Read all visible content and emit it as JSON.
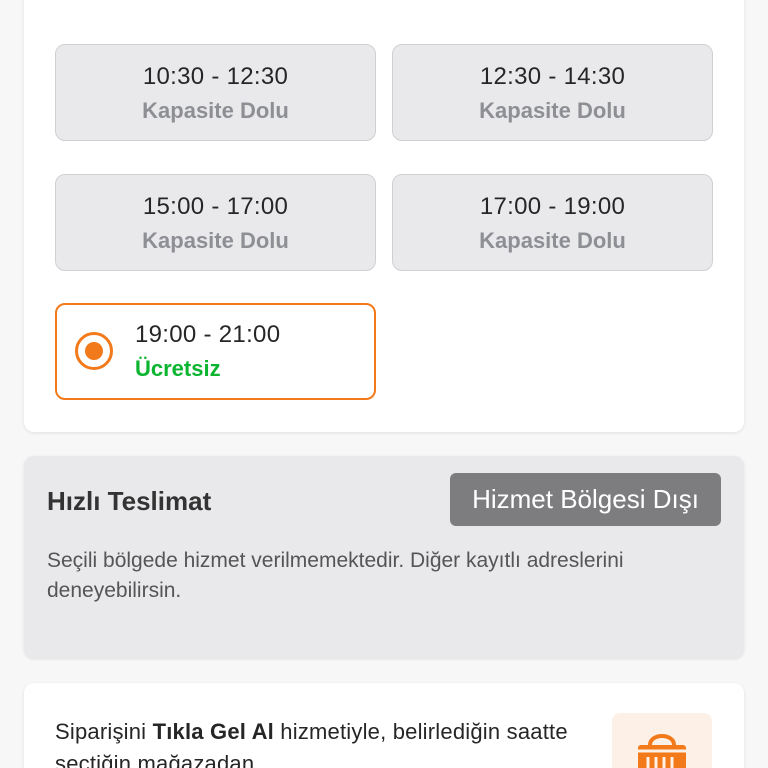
{
  "delivery_slots": {
    "slots": [
      {
        "time": "10:30 - 12:30",
        "status": "Kapasite Dolu"
      },
      {
        "time": "12:30 - 14:30",
        "status": "Kapasite Dolu"
      },
      {
        "time": "15:00 - 17:00",
        "status": "Kapasite Dolu"
      },
      {
        "time": "17:00 - 19:00",
        "status": "Kapasite Dolu"
      }
    ],
    "selected_slot": {
      "time": "19:00 - 21:00",
      "status": "Ücretsiz"
    }
  },
  "fast_delivery": {
    "title": "Hızlı Teslimat",
    "badge": "Hizmet Bölgesi Dışı",
    "description": "Seçili bölgede hizmet verilmemektedir. Diğer kayıtlı adreslerini deneyebilirsin."
  },
  "click_collect": {
    "text_before": "Siparişini ",
    "text_bold": "Tıkla Gel Al",
    "text_after": " hizmetiyle, belirlediğin saatte seçtiğin mağazadan",
    "icon": "store-bag-icon"
  },
  "colors": {
    "accent": "#f27a1a",
    "free": "#0bb52f",
    "disabled_text": "#8d8f94",
    "badge_bg": "#7d7d80"
  }
}
